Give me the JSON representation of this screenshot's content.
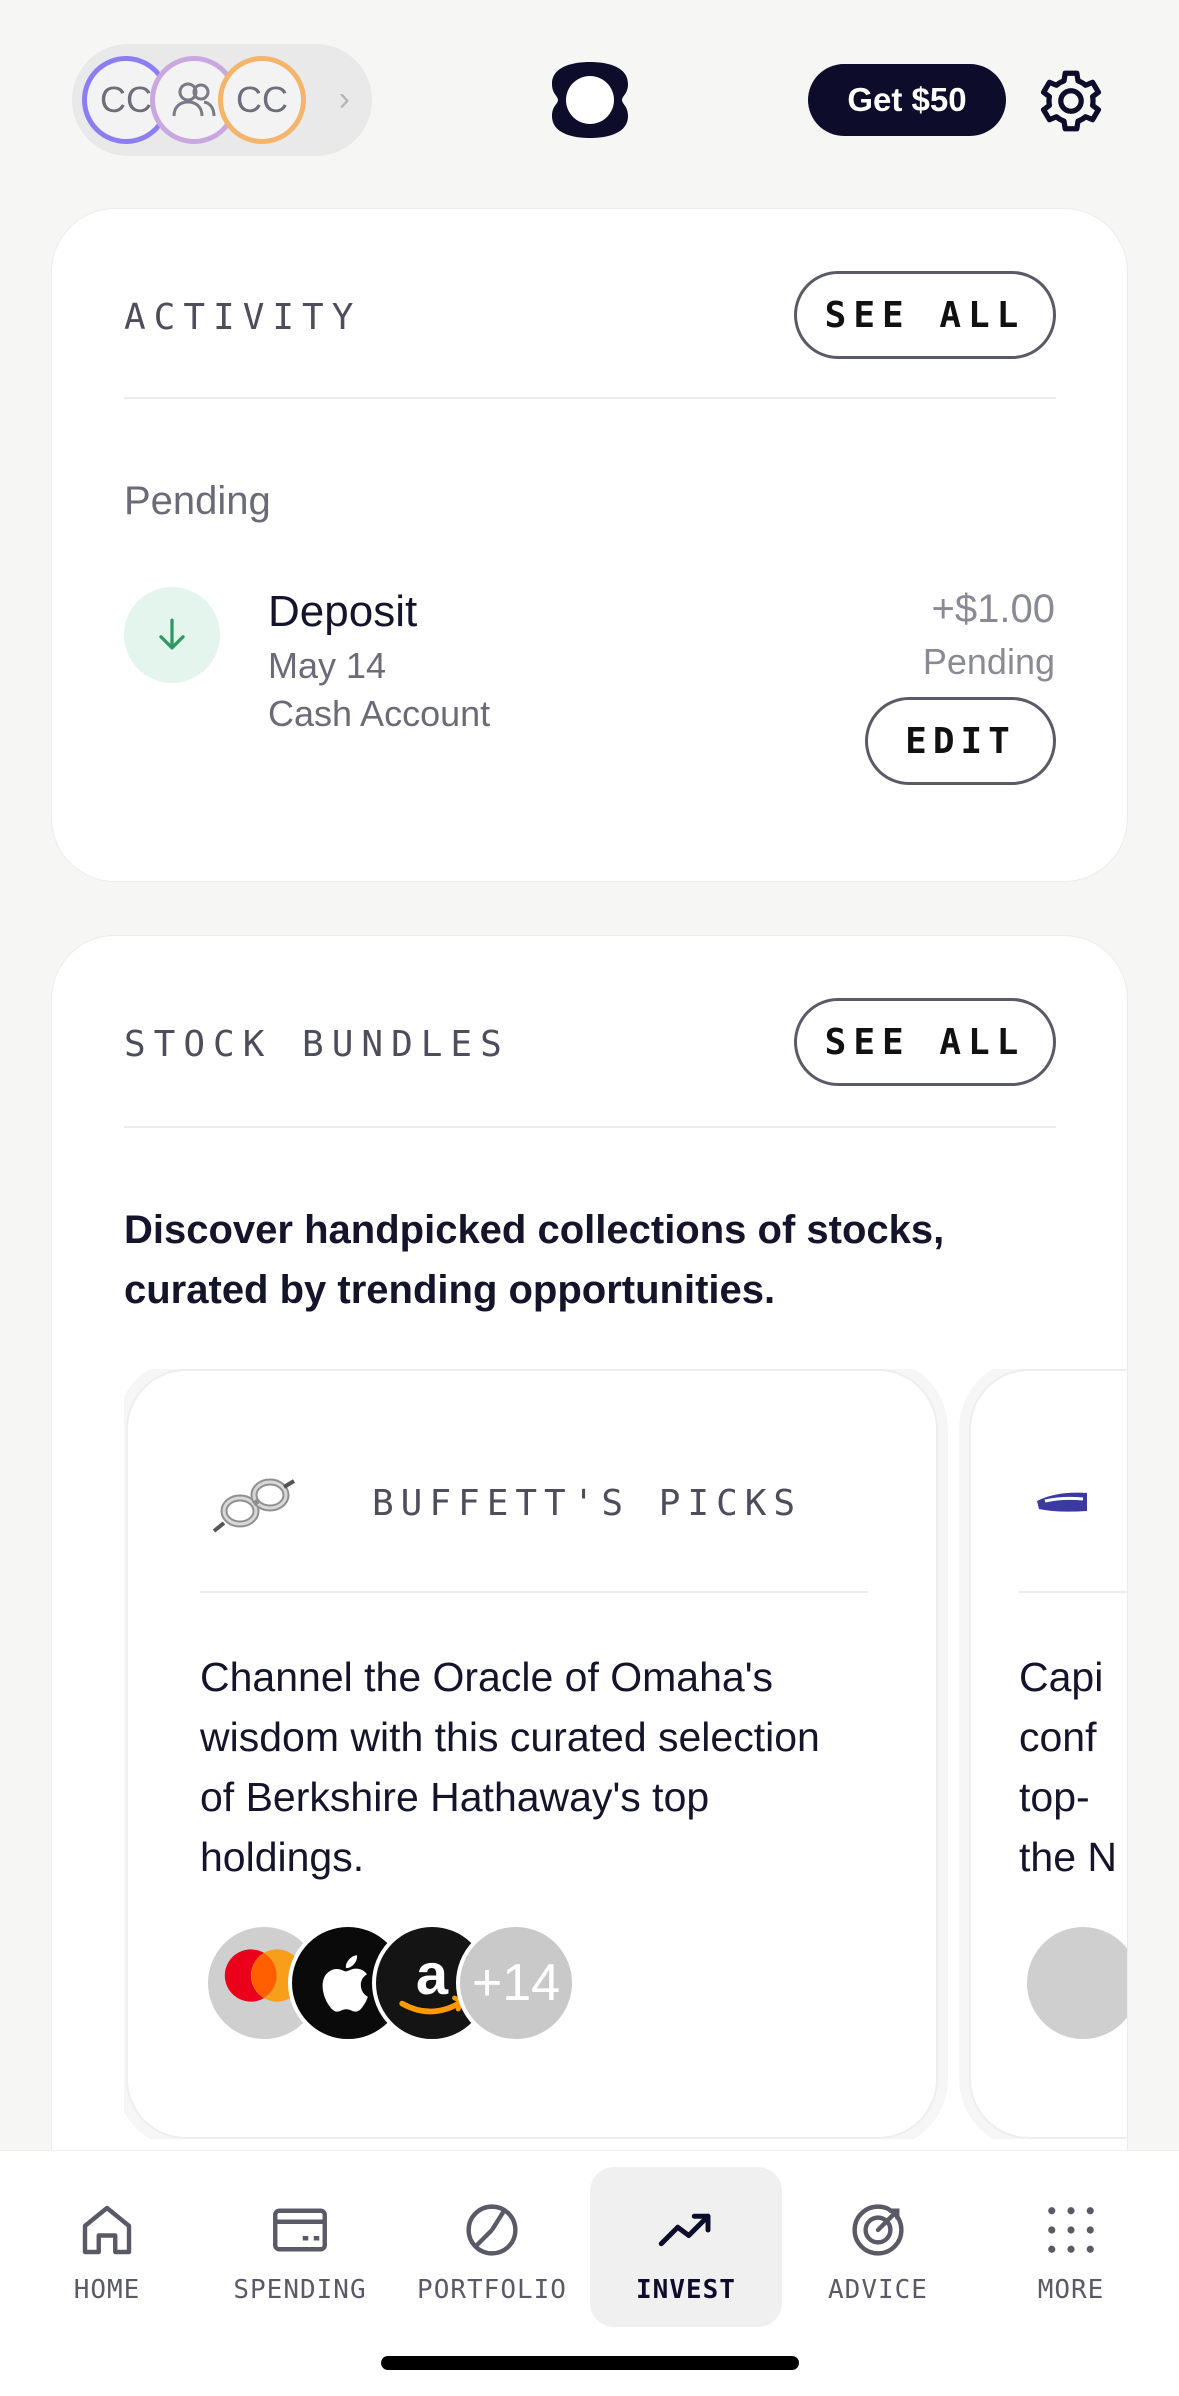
{
  "header": {
    "accounts": [
      "CC",
      "CC"
    ],
    "cta_label": "Get $50"
  },
  "activity": {
    "title": "ACTIVITY",
    "see_all": "SEE ALL",
    "pending_heading": "Pending",
    "transaction": {
      "title": "Deposit",
      "date": "May 14",
      "account": "Cash Account",
      "amount": "+$1.00",
      "status": "Pending",
      "edit_label": "EDIT"
    }
  },
  "bundles": {
    "title": "STOCK BUNDLES",
    "see_all": "SEE ALL",
    "description": "Discover handpicked collections of stocks, curated by trending opportunities.",
    "cards": [
      {
        "name": "BUFFETT'S PICKS",
        "description": "Channel the Oracle of Omaha's wisdom with this curated selection of Berkshire Hathaway's top holdings.",
        "more_count": "+14"
      },
      {
        "description_lines": [
          "Capi",
          "conf",
          "top-",
          "the N"
        ]
      }
    ]
  },
  "nav": {
    "items": [
      {
        "label": "HOME"
      },
      {
        "label": "SPENDING"
      },
      {
        "label": "PORTFOLIO"
      },
      {
        "label": "INVEST"
      },
      {
        "label": "ADVICE"
      },
      {
        "label": "MORE"
      }
    ],
    "active": "INVEST"
  },
  "colors": {
    "primary": "#0d0c2a",
    "deposit_green": "#2e9a62",
    "deposit_bg": "#e3f5ec"
  }
}
